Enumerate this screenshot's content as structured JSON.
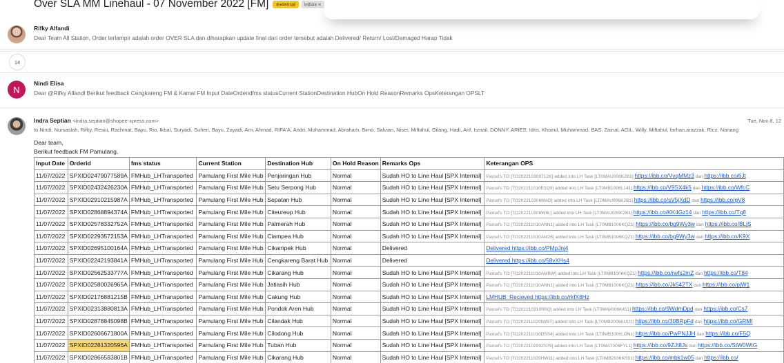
{
  "thread": {
    "subject": "Over SLA MM Linehaul - 07 November 2022 [FM]",
    "label_external": "External",
    "label_inbox": "Inbox",
    "label_inbox_close": "×"
  },
  "messages": [
    {
      "sender": "Rifky Alfandi",
      "snippet": "Dear Team All Station, Order terlampir adalah order OVER SLA dan diharapkan update final dari order tersebut adalah Delivered/ Return/ Lost/Damaged Harap Tidak"
    },
    {
      "collapsed_count": "14"
    },
    {
      "avatar_letter": "N",
      "sender": "Nindi Elisa",
      "snippet": "Dear @Rifky Alfandi Berikut feedback Cengkareng FM & Kamal FM Input DateOrderidfms statusCurrent StationDestination HubOn Hold ReasonRemarks OpsKeterangan OPSLT"
    },
    {
      "sender": "Indra Septian",
      "email": "<indra.septian@shopee-xpress.com>",
      "date": "Tue, Nov 8, 12",
      "recipients": "to Nindi, Nursaslah, Rifky, Restu, Rachmat, Bayu, Rio, Ikbal, Suryadi, Suheri, Bayu, Zayadi, Arri, Ahmad, RIFA'A, Andri, Mohammad, Abraham, Bimo, Salvian, Niser, Miftahul, Gilang, Hadi, Arif, Ismail, DONNY, ARIES, Idris, Khoirul, Muhammad, BAS, Zainal, AGIL, Willy, Miftahul, farhan.arazzak, Rico, Nanang",
      "greeting": "Dear team,",
      "intro": "Berikut feedback FM Pamulang,"
    }
  ],
  "table": {
    "headers": [
      "Input Date",
      "Orderid",
      "fms status",
      "Current Station",
      "Destination Hub",
      "On Hold Reason",
      "Remarks Ops",
      "Keterangan OPS"
    ],
    "rows": [
      [
        "11/07/2022",
        "SPXID02479077589A",
        "FMHub_LHTransported",
        "Pamulang First Mile Hub",
        "Penjaringan Hub",
        "Normal",
        "Sudah HO to Line Haul [SPX Internal]",
        "Parcel's TO [TO202210300712K] added into LH Task [LT0MAU006K2B1]",
        "https://ibb.co/VvqMMz3",
        "dan",
        "https://ibb.co/6Jt"
      ],
      [
        "11/07/2022",
        "SPXID02432426230A",
        "FMHub_LHTransported",
        "Pamulang First Mile Hub",
        "Setu Serpong Hub",
        "Normal",
        "Sudah HO to Line Haul [SPX Internal]",
        "Parcel's TO [TO202211010E1Q9] added into LH Task [LT0MB1006L141]",
        "https://ibb.co/V9SX4k5",
        "dan",
        "https://ibb.co/WfcC"
      ],
      [
        "11/07/2022",
        "SPXID02910215987A",
        "FMHub_LHTransported",
        "Pamulang First Mile Hub",
        "Sepatan Hub",
        "Normal",
        "Sudah HO to Line Haul [SPX Internal]",
        "Parcel's TO [TO202210306MAD] added into LH Task [LT0MAU006K2B1]",
        "https://ibb.co/sV5jXdD",
        "dan",
        "https://ibb.co/gV8"
      ],
      [
        "11/07/2022",
        "SPXID02868894374A",
        "FMHub_LHTransported",
        "Pamulang First Mile Hub",
        "Citeureup Hub",
        "Normal",
        "Sudah HO to Line Haul [SPX Internal]",
        "Parcel's TO [TO202210306W6L] added into LH Task [LT0MAU006K2B1]",
        "https://ibb.co/KK4Gz14",
        "dan",
        "https://ibb.co/Tq8"
      ],
      [
        "11/07/2022",
        "SPXID02578332752A",
        "FMHub_LHTransported",
        "Pamulang First Mile Hub",
        "Palmerah Hub",
        "Normal",
        "Sudah HO to Line Haul [SPX Internal]",
        "Parcel's TO [TO202211010ANN1] added into LH Task [LT0MB1006KQZ1]",
        "https://ibb.co/bg9Wy3w",
        "dan",
        "https://ibb.co/BLjS"
      ],
      [
        "11/07/2022",
        "SPXID02293572153A",
        "FMHub_LHTransported",
        "Pamulang First Mile Hub",
        "Ciampea Hub",
        "Normal",
        "Sudah HO to Line Haul [SPX Internal]",
        "Parcel's TO [TO202211010AM26] added into LH Task [LT0MB1006KQZ1]",
        "https://ibb.co/bg9Wy3w",
        "dan",
        "https://ibb.co/K9X"
      ],
      [
        "11/07/2022",
        "SPXID02695100164A",
        "FMHub_LHTransported",
        "Pamulang First Mile Hub",
        "Cikampek Hub",
        "Normal",
        "Delivered",
        "",
        "Delivered https://ibb.co/PMpJnj4",
        "",
        ""
      ],
      [
        "11/07/2022",
        "SPXID02242193841A",
        "FMHub_LHTransported",
        "Pamulang First Mile Hub",
        "Cengkareng Barat Hub",
        "Normal",
        "Delivered",
        "",
        "Delivered https://ibb.co/58vXHs4",
        "",
        ""
      ],
      [
        "11/07/2022",
        "SPXID02562533777A",
        "FMHub_LHTransported",
        "Pamulang First Mile Hub",
        "Cikarang Hub",
        "Normal",
        "Sudah HO to Line Haul [SPX Internal]",
        "Parcel's TO [TO202211010AMBW] added into LH Task [LT0MB1006KQZ1]",
        "https://ibb.co/rwfs2mZ",
        "dan",
        "https://ibb.co/T84"
      ],
      [
        "11/07/2022",
        "SPXID02580026965A",
        "FMHub_LHTransported",
        "Pamulang First Mile Hub",
        "Jatiasih Hub",
        "Normal",
        "Sudah HO to Line Haul [SPX Internal]",
        "Parcel's TO [TO202211010ANN1] added into LH Task [LT0MB1006KQZ1]",
        "https://ibb.co/Jk542TX",
        "dan",
        "https://ibb.co/pjW1"
      ],
      [
        "11/07/2022",
        "SPXID02176881215B",
        "FMHub_LHTransported",
        "Pamulang First Mile Hub",
        "Cakung Hub",
        "Normal",
        "Sudah HO to Line Haul [SPX Internal]",
        "",
        "LMHUB_Recieved https://ibb.co/rkfX8Hz",
        "",
        ""
      ],
      [
        "11/07/2022",
        "SPXID02313880813A",
        "FMHub_LHTransported",
        "Pamulang First Mile Hub",
        "Pondok Aren Hub",
        "Normal",
        "Sudah HO to Line Haul [SPX Internal]",
        "Parcel's TO [TO202210310R6Q] added into LH Task [LT0MAV006K451]",
        "https://ibb.co/9WdmDpd",
        "dan",
        "https://ibb.co/Cs7"
      ],
      [
        "11/07/2022",
        "SPXID02878845098B",
        "FMHub_LHTransported",
        "Pamulang First Mile Hub",
        "Cilandak Hub",
        "Normal",
        "Sudah HO to Line Haul [SPX Internal]",
        "Parcel's TO [TO202211020IWBT] added into LH Task [LT0MB2006KUU1]",
        "https://ibb.co/30BRpFd",
        "dan",
        "https://ibb.co/GRMI"
      ],
      [
        "11/07/2022",
        "SPXID02606671800A",
        "FMHub_LHTransported",
        "Pamulang First Mile Hub",
        "Cilodong Hub",
        "Normal",
        "Sudah HO to Line Haul [SPX Internal]",
        "Parcel's TO [TO202211010DSS4] added into LH Task [LT0MB1006LON1]",
        "https://ibb.co/PwPNJJH",
        "dan",
        "https://ibb.co/F5Q"
      ],
      [
        "11/07/2022",
        "SPXID02281320596A",
        "FMHub_LHTransported",
        "Pamulang First Mile Hub",
        "Tuban Hub",
        "Normal",
        "Sudah HO to Line Haul [SPX Internal]",
        "Parcel's TO [TO2022102902S75] added into LH Task [LT0MAT006FYL1]",
        "https://ibb.co/9ZJt8Js",
        "dan",
        "https://ibb.co/StW0WtG"
      ],
      [
        "11/07/2022",
        "SPXID02866583801B",
        "FMHub_LHTransported",
        "Pamulang First Mile Hub",
        "Cikarang Hub",
        "Normal",
        "Sudah HO to Line Haul [SPX Internal]",
        "Parcel's TO [TO202211020HW11] added into LH Task [LT0MB2006KR01]",
        "https://ibb.co/mbk1w05",
        "dan",
        "https://ibb.co/"
      ]
    ],
    "highlighted_orderid": "SPXID02281320596A"
  }
}
